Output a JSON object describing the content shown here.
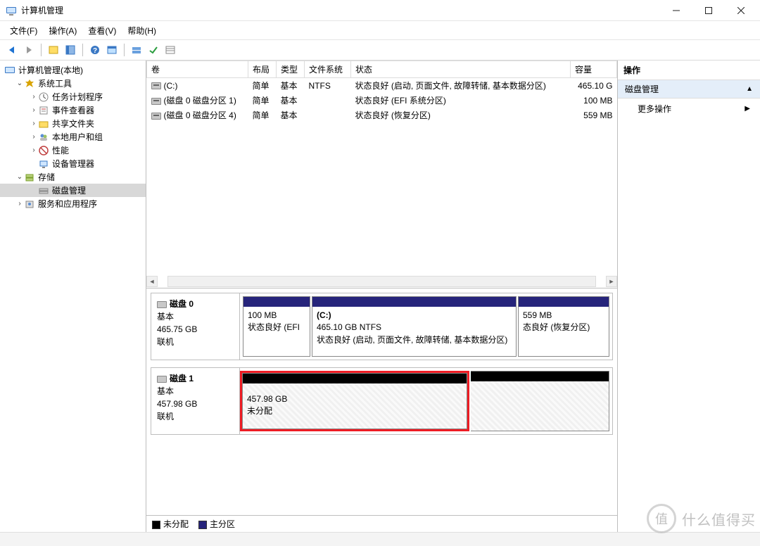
{
  "window": {
    "title": "计算机管理"
  },
  "menu": {
    "file": "文件(F)",
    "action": "操作(A)",
    "view": "查看(V)",
    "help": "帮助(H)"
  },
  "tree": {
    "root": "计算机管理(本地)",
    "sys_tools": "系统工具",
    "task_scheduler": "任务计划程序",
    "event_viewer": "事件查看器",
    "shared_folders": "共享文件夹",
    "local_users": "本地用户和组",
    "performance": "性能",
    "device_manager": "设备管理器",
    "storage": "存储",
    "disk_management": "磁盘管理",
    "services_apps": "服务和应用程序"
  },
  "table": {
    "headers": {
      "volume": "卷",
      "layout": "布局",
      "type": "类型",
      "fs": "文件系统",
      "status": "状态",
      "capacity": "容量"
    },
    "rows": [
      {
        "volume": "(C:)",
        "layout": "简单",
        "type": "基本",
        "fs": "NTFS",
        "status": "状态良好 (启动, 页面文件, 故障转储, 基本数据分区)",
        "capacity": "465.10 G"
      },
      {
        "volume": "(磁盘 0 磁盘分区 1)",
        "layout": "简单",
        "type": "基本",
        "fs": "",
        "status": "状态良好 (EFI 系统分区)",
        "capacity": "100 MB"
      },
      {
        "volume": "(磁盘 0 磁盘分区 4)",
        "layout": "简单",
        "type": "基本",
        "fs": "",
        "status": "状态良好 (恢复分区)",
        "capacity": "559 MB"
      }
    ]
  },
  "disks": {
    "disk0": {
      "name": "磁盘 0",
      "kind": "基本",
      "size": "465.75 GB",
      "state": "联机",
      "parts": [
        {
          "size": "100 MB",
          "status": "状态良好 (EFI 系统分区)",
          "status_short": "状态良好 (EFI"
        },
        {
          "label": "(C:)",
          "size": "465.10 GB NTFS",
          "status": "状态良好 (启动, 页面文件, 故障转储, 基本数据分区)"
        },
        {
          "size": "559 MB",
          "status": "状态良好 (恢复分区)",
          "status_short": "态良好 (恢复分区)"
        }
      ]
    },
    "disk1": {
      "name": "磁盘 1",
      "kind": "基本",
      "size": "457.98 GB",
      "state": "联机",
      "unalloc": {
        "size": "457.98 GB",
        "label": "未分配"
      }
    }
  },
  "legend": {
    "unalloc": "未分配",
    "primary": "主分区"
  },
  "actions": {
    "header": "操作",
    "section": "磁盘管理",
    "more": "更多操作"
  },
  "watermark": {
    "badge": "值",
    "text": "什么值得买"
  }
}
